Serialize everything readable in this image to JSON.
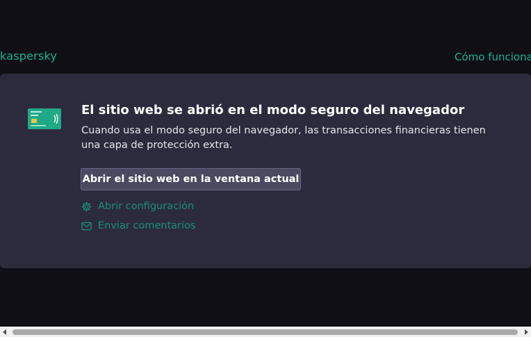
{
  "header": {
    "logo_text": "kaspersky",
    "how_it_works_link": "Cómo funciona"
  },
  "card": {
    "icon": "bank-card-icon",
    "title": "El sitio web se abrió en el modo seguro del navegador",
    "description": "Cuando usa el modo seguro del navegador, las transacciones financieras tienen una capa de protección extra.",
    "primary_button_label": "Abrir el sitio web en la ventana actual",
    "links": {
      "settings": {
        "icon": "gear-icon",
        "label": "Abrir configuración"
      },
      "feedback": {
        "icon": "envelope-icon",
        "label": "Enviar comentarios"
      }
    }
  },
  "colors": {
    "background": "#0f0f15",
    "card_background": "#2c2b3e",
    "accent": "#1bb394",
    "link": "#1b8f74",
    "button": "#4a4960"
  }
}
